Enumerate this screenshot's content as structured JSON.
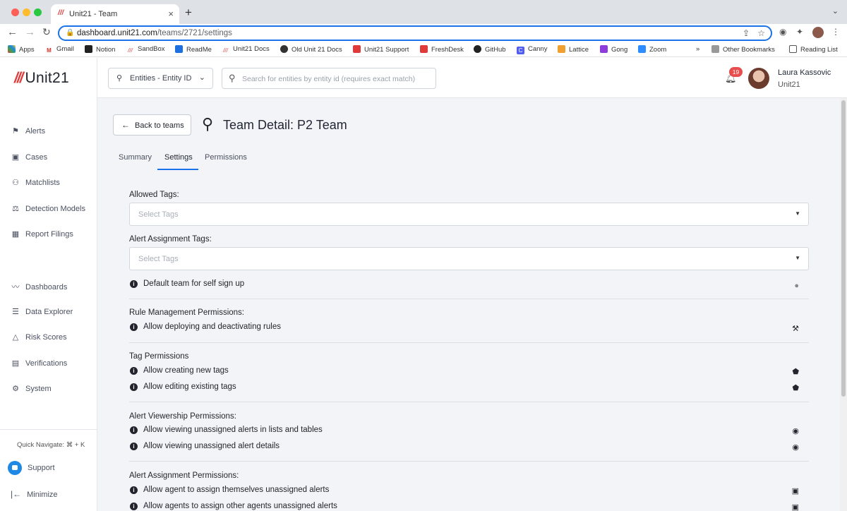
{
  "browser": {
    "tab_title": "Unit21 - Team",
    "url_host": "dashboard.unit21.com",
    "url_path": "/teams/2721/settings",
    "bookmarks": [
      "Apps",
      "Gmail",
      "Notion",
      "SandBox",
      "ReadMe",
      "Unit21 Docs",
      "Old Unit 21 Docs",
      "Unit21 Support",
      "FreshDesk",
      "GitHub",
      "Canny",
      "Lattice",
      "Gong",
      "Zoom"
    ],
    "other_bookmarks": "Other Bookmarks",
    "reading_list": "Reading List",
    "more": "»"
  },
  "logo": "Unit21",
  "sidebar": {
    "items": [
      {
        "label": "Alerts",
        "icon": "flag-icon"
      },
      {
        "label": "Cases",
        "icon": "briefcase-icon"
      },
      {
        "label": "Matchlists",
        "icon": "user-x-icon"
      },
      {
        "label": "Detection Models",
        "icon": "scale-icon"
      },
      {
        "label": "Report Filings",
        "icon": "building-icon"
      },
      {
        "label": "Dashboards",
        "icon": "chart-line-icon"
      },
      {
        "label": "Data Explorer",
        "icon": "search-list-icon"
      },
      {
        "label": "Risk Scores",
        "icon": "warning-icon"
      },
      {
        "label": "Verifications",
        "icon": "id-card-icon"
      },
      {
        "label": "System",
        "icon": "gear-icon"
      }
    ],
    "quick_navigate": "Quick Navigate: ⌘ + K",
    "support": "Support",
    "minimize": "Minimize"
  },
  "topbar": {
    "entity_select": "Entities - Entity ID",
    "search_placeholder": "Search for entities by entity id (requires exact match)",
    "notification_count": "19",
    "user_name": "Laura Kassovic",
    "user_org": "Unit21"
  },
  "page": {
    "back_label": "Back to teams",
    "title": "Team Detail: P2 Team",
    "tabs": [
      "Summary",
      "Settings",
      "Permissions"
    ],
    "active_tab": "Settings"
  },
  "settings": {
    "allowed_tags_label": "Allowed Tags:",
    "allowed_tags_placeholder": "Select Tags",
    "alert_assignment_tags_label": "Alert Assignment Tags:",
    "alert_assignment_tags_placeholder": "Select Tags",
    "default_team": "Default team for self sign up",
    "rule_mgmt_title": "Rule Management Permissions:",
    "rule_mgmt_item": "Allow deploying and deactivating rules",
    "tag_perm_title": "Tag Permissions",
    "tag_perm_items": [
      "Allow creating new tags",
      "Allow editing existing tags"
    ],
    "viewership_title": "Alert Viewership Permissions:",
    "viewership_items": [
      "Allow viewing unassigned alerts in lists and tables",
      "Allow viewing unassigned alert details"
    ],
    "assignment_title": "Alert Assignment Permissions:",
    "assignment_items": [
      "Allow agent to assign themselves unassigned alerts",
      "Allow agents to assign other agents unassigned alerts"
    ]
  }
}
